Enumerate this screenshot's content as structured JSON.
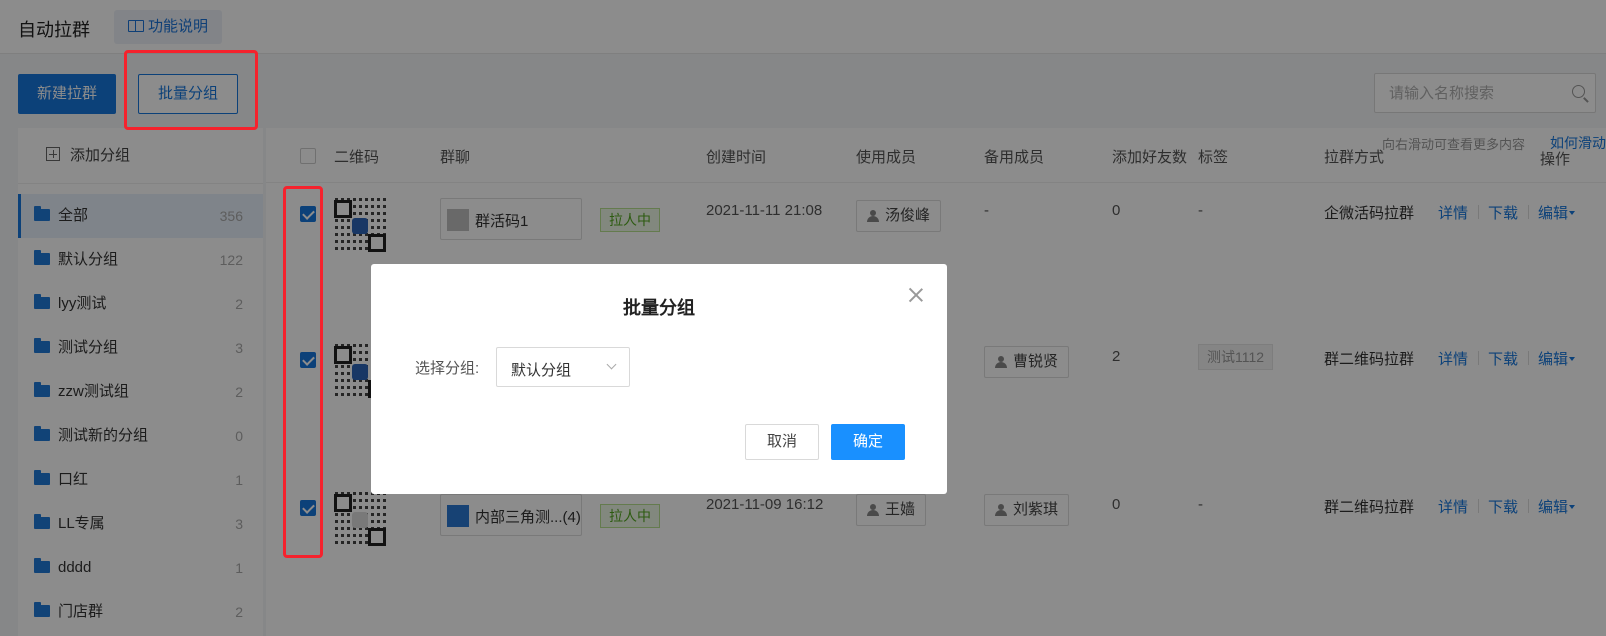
{
  "header": {
    "title": "自动拉群",
    "help_tab": "功能说明"
  },
  "toolbar": {
    "new_button": "新建拉群",
    "batch_group_button": "批量分组",
    "search_placeholder": "请输入名称搜索"
  },
  "sidebar": {
    "add_group": "添加分组",
    "items": [
      {
        "label": "全部",
        "count": "356",
        "active": true
      },
      {
        "label": "默认分组",
        "count": "122"
      },
      {
        "label": "lyy测试",
        "count": "2"
      },
      {
        "label": "测试分组",
        "count": "3"
      },
      {
        "label": "zzw测试组",
        "count": "2"
      },
      {
        "label": "测试新的分组",
        "count": "0"
      },
      {
        "label": "口红",
        "count": "1"
      },
      {
        "label": "LL专属",
        "count": "3"
      },
      {
        "label": "dddd",
        "count": "1"
      },
      {
        "label": "门店群",
        "count": "2"
      }
    ]
  },
  "table": {
    "scroll_hint": "向右滑动可查看更多内容",
    "scroll_link": "如何滑动",
    "columns": [
      "二维码",
      "群聊",
      "创建时间",
      "使用成员",
      "备用成员",
      "添加好友数",
      "标签",
      "拉群方式",
      "操作"
    ],
    "rows": [
      {
        "checked": true,
        "group_name": "群活码1",
        "status": "拉人中",
        "created": "2021-11-11 21:08",
        "member": "汤俊峰",
        "backup": "-",
        "friends": "0",
        "tag": "-",
        "method": "企微活码拉群",
        "actions": [
          "详情",
          "下载",
          "编辑"
        ]
      },
      {
        "checked": true,
        "group_name": "",
        "status": "",
        "created": "",
        "member": "",
        "backup": "曹锐贤",
        "friends": "2",
        "tag": "测试1112",
        "method": "群二维码拉群",
        "actions": [
          "详情",
          "下载",
          "编辑"
        ]
      },
      {
        "checked": true,
        "group_name": "内部三角测...(4)",
        "status": "拉人中",
        "created": "2021-11-09 16:12",
        "member": "王嫱",
        "backup": "刘紫琪",
        "friends": "0",
        "tag": "-",
        "method": "群二维码拉群",
        "actions": [
          "详情",
          "下载",
          "编辑"
        ]
      }
    ]
  },
  "modal": {
    "title": "批量分组",
    "field_label": "选择分组:",
    "selected": "默认分组",
    "cancel": "取消",
    "confirm": "确定"
  },
  "colors": {
    "primary": "#1677dd",
    "confirm": "#1990ff",
    "highlight": "#f5222d",
    "status_green": "#52a61f"
  }
}
